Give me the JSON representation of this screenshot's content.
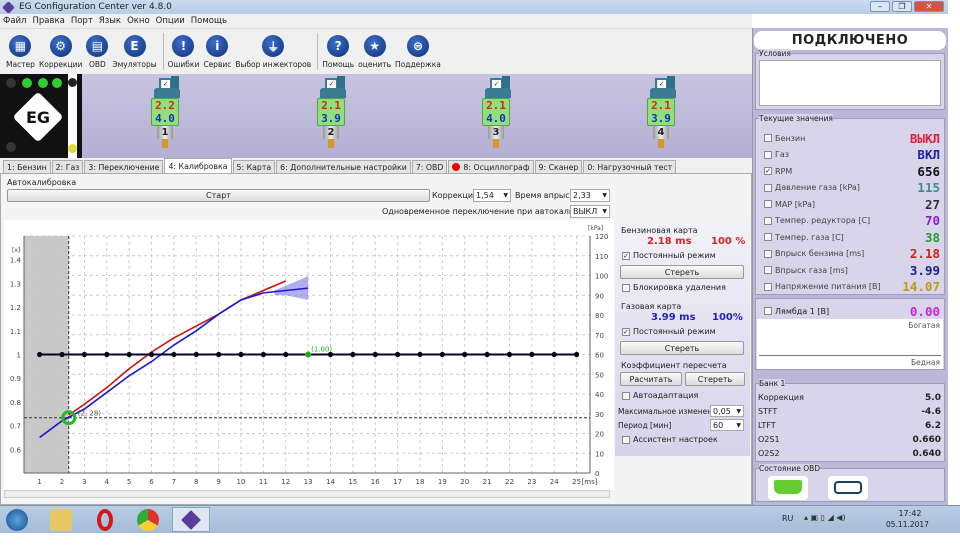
{
  "window": {
    "title": "EG Configuration Center ver 4.8.0",
    "minimize": "–",
    "restore": "❐",
    "close": "✕"
  },
  "menu": [
    "Файл",
    "Правка",
    "Порт",
    "Язык",
    "Окно",
    "Опции",
    "Помощь"
  ],
  "toolbar": [
    {
      "label": "Мастер",
      "icon": "grid-icon",
      "glyph": "▦"
    },
    {
      "label": "Коррекции",
      "icon": "gear-icon",
      "glyph": "⚙"
    },
    {
      "label": "OBD",
      "icon": "keyboard-icon",
      "glyph": "▤"
    },
    {
      "label": "Эмуляторы",
      "icon": "emulator-icon",
      "glyph": "E"
    },
    {
      "sep": true
    },
    {
      "label": "Ошибки",
      "icon": "exclamation-icon",
      "glyph": "!"
    },
    {
      "label": "Сервис",
      "icon": "info-icon",
      "glyph": "i"
    },
    {
      "label": "Выбор инжекторов",
      "icon": "injector-icon",
      "glyph": "⏚"
    },
    {
      "sep": true
    },
    {
      "label": "Помощь",
      "icon": "help-icon",
      "glyph": "?"
    },
    {
      "label": "оценить",
      "icon": "star-icon",
      "glyph": "★"
    },
    {
      "label": "Поддержка",
      "icon": "support-icon",
      "glyph": "⊜"
    }
  ],
  "logo": {
    "text": "EG"
  },
  "injectors": [
    {
      "num": "1",
      "petrol": "2.2",
      "gas": "4.0",
      "checked": "✓"
    },
    {
      "num": "2",
      "petrol": "2.1",
      "gas": "3.9",
      "checked": "✓"
    },
    {
      "num": "3",
      "petrol": "2.1",
      "gas": "4.0",
      "checked": "✓"
    },
    {
      "num": "4",
      "petrol": "2.1",
      "gas": "3.9",
      "checked": "✓"
    }
  ],
  "tabs": [
    {
      "label": "1: Бензин"
    },
    {
      "label": "2: Газ"
    },
    {
      "label": "3: Переключение"
    },
    {
      "label": "4: Калибровка",
      "active": true
    },
    {
      "label": "5: Карта"
    },
    {
      "label": "6: Дополнительные настройки"
    },
    {
      "label": "7: OBD"
    },
    {
      "label": "8: Осциллограф",
      "rec": true
    },
    {
      "label": "9: Сканер"
    },
    {
      "label": "0: Нагрузочный тест"
    }
  ],
  "autocal": {
    "title": "Автокалибровка",
    "start": "Старт",
    "correction_label": "Коррекция",
    "correction_value": "1,54",
    "inject_label": "Время впрыска",
    "inject_value": "2,33",
    "simul_label": "Одновременное переключение при автокалибровке",
    "simul_value": "ВЫКЛ"
  },
  "petrol_map": {
    "title": "Бензиновая карта",
    "ms": "2.18 ms",
    "pct": "100 %",
    "constant": "Постоянный режим",
    "constant_checked": true,
    "erase": "Стереть",
    "lock": "Блокировка удаления"
  },
  "gas_map": {
    "title": "Газовая карта",
    "ms": "3.99 ms",
    "pct": "100%",
    "constant": "Постоянный режим",
    "constant_checked": true,
    "erase": "Стереть"
  },
  "coef": {
    "title": "Коэффициент пересчета",
    "calc": "Расчитать",
    "erase": "Стереть",
    "autoadapt": "Автоадаптация",
    "max_change_label": "Максимальное изменение",
    "max_change_value": "0,05",
    "period_label": "Период [мин]",
    "period_value": "60",
    "assistant": "Ассистент настроек"
  },
  "status": {
    "connected": "ПОДКЛЮЧЕНО",
    "conditions": "Условия"
  },
  "current": {
    "title": "Текущие значения",
    "items": [
      {
        "label": "Бензин",
        "value": "ВЫКЛ",
        "color": "#e0203a",
        "checked": false
      },
      {
        "label": "Газ",
        "value": "ВКЛ",
        "color": "#1a23b0",
        "checked": false
      },
      {
        "label": "RPM",
        "value": "656",
        "color": "#111111",
        "checked": true
      },
      {
        "label": "Давление газа [kPa]",
        "value": "115",
        "color": "#3f8a93",
        "checked": false
      },
      {
        "label": "MAP [kPa]",
        "value": "27",
        "color": "#333333",
        "checked": false
      },
      {
        "label": "Темпер. редуктора [C]",
        "value": "70",
        "color": "#8a1ad0",
        "checked": false
      },
      {
        "label": "Темпер. газа [C]",
        "value": "38",
        "color": "#2a9a2a",
        "checked": false
      },
      {
        "label": "Впрыск бензина [ms]",
        "value": "2.18",
        "color": "#d0201a",
        "checked": false
      },
      {
        "label": "Впрыск газа [ms]",
        "value": "3.99",
        "color": "#1a2090",
        "checked": false
      },
      {
        "label": "Напряжение питания [B]",
        "value": "14.07",
        "color": "#c09a10",
        "checked": false
      }
    ]
  },
  "lambda": {
    "label": "Лямбда 1 [B]",
    "value": "0.00",
    "color": "#d020d0",
    "rich": "Богатая",
    "lean": "Бедная"
  },
  "bank": {
    "title": "Банк 1",
    "items": [
      {
        "label": "Коррекция",
        "value": "5.0"
      },
      {
        "label": "STFT",
        "value": "-4.6"
      },
      {
        "label": "LTFT",
        "value": "6.2"
      },
      {
        "label": "O2S1",
        "value": "0.660"
      },
      {
        "label": "O2S2",
        "value": "0.640"
      }
    ]
  },
  "obd": {
    "title": "Состояние OBD"
  },
  "taskbar": {
    "lang": "RU",
    "time": "17:42",
    "date": "05.11.2017"
  },
  "chart_data": {
    "type": "line",
    "xlabel": "[ms]",
    "ylabel": "[x]",
    "y2label": "[kPa]",
    "xlim": [
      0.3,
      25.6
    ],
    "ylim": [
      0.5,
      1.5
    ],
    "y2lim": [
      0,
      120
    ],
    "xticks": [
      1,
      2,
      3,
      4,
      5,
      6,
      7,
      8,
      9,
      10,
      11,
      12,
      13,
      14,
      15,
      16,
      17,
      18,
      19,
      20,
      21,
      22,
      23,
      24,
      25
    ],
    "yticks": [
      0.6,
      0.7,
      0.8,
      0.9,
      1.0,
      1.1,
      1.2,
      1.3,
      1.4
    ],
    "y2ticks": [
      0,
      10,
      20,
      30,
      40,
      50,
      60,
      70,
      80,
      90,
      100,
      110,
      120
    ],
    "grid": true,
    "series": [
      {
        "color": "#cc1111",
        "x": [
          2.3,
          3,
          4,
          5,
          6,
          7,
          8,
          9,
          10,
          11,
          12
        ],
        "y": [
          0.745,
          0.79,
          0.86,
          0.94,
          1.01,
          1.07,
          1.12,
          1.17,
          1.23,
          1.27,
          1.31
        ]
      },
      {
        "color": "#1a1ad0",
        "x": [
          1,
          2,
          3,
          4,
          5,
          6,
          7,
          8,
          9,
          10,
          11,
          12,
          13
        ],
        "y": [
          0.65,
          0.72,
          0.77,
          0.84,
          0.91,
          0.97,
          1.04,
          1.1,
          1.17,
          1.23,
          1.26,
          1.27,
          1.28
        ]
      },
      {
        "color": "#000033",
        "x": [
          1,
          2,
          3,
          4,
          5,
          6,
          7,
          8,
          9,
          10,
          11,
          12,
          13,
          14,
          15,
          16,
          17,
          18,
          19,
          20,
          21,
          22,
          23,
          24,
          25
        ],
        "y": [
          1,
          1,
          1,
          1,
          1,
          1,
          1,
          1,
          1,
          1,
          1,
          1,
          1,
          1,
          1,
          1,
          1,
          1,
          1,
          1,
          1,
          1,
          1,
          1,
          1
        ]
      }
    ],
    "band": {
      "color": "#7878e8",
      "x": [
        11.5,
        12,
        12.5,
        13
      ],
      "upper": [
        1.27,
        1.29,
        1.31,
        1.33
      ],
      "lower": [
        1.25,
        1.25,
        1.24,
        1.23
      ]
    },
    "operating_point": {
      "x": 2.3,
      "kpa": 28,
      "label": "(2, 28)"
    },
    "selected_point": {
      "x": 13,
      "y": 1.0,
      "label": "(1.00)"
    },
    "shaded_until": 2.3
  }
}
